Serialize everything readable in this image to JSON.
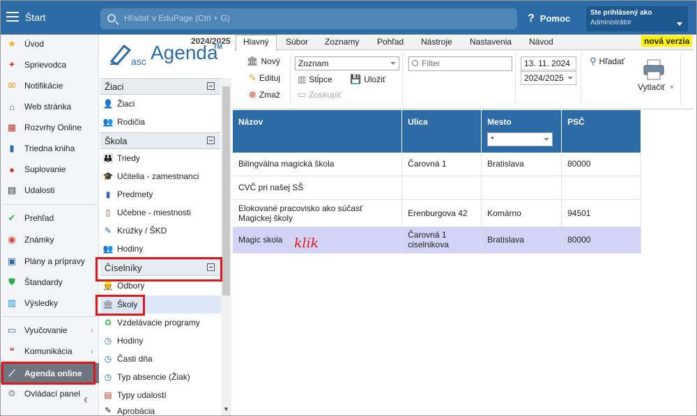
{
  "header": {
    "start_label": "Štart",
    "search_placeholder": "Hľadať v EduPage (Ctrl + G)",
    "help_label": "Pomoc",
    "user_line1": "Ste prihlásený ako",
    "user_line2": "Administrátor"
  },
  "leftnav": {
    "items": [
      {
        "label": "Úvod",
        "icon": "star-icon"
      },
      {
        "label": "Sprievodca",
        "icon": "wand-icon"
      },
      {
        "label": "Notifikácie",
        "icon": "envelope-icon"
      },
      {
        "label": "Web stránka",
        "icon": "home-icon"
      },
      {
        "label": "Rozvrhy Online",
        "icon": "grid-icon"
      },
      {
        "label": "Triedna kniha",
        "icon": "book-icon"
      },
      {
        "label": "Suplovanie",
        "icon": "person-icon"
      },
      {
        "label": "Udalosti",
        "icon": "calendar-icon"
      },
      {
        "label": "Prehľad",
        "icon": "check-circle-icon"
      },
      {
        "label": "Známky",
        "icon": "grade-icon"
      },
      {
        "label": "Plány a prípravy",
        "icon": "briefcase-icon"
      },
      {
        "label": "Štandardy",
        "icon": "shield-icon"
      },
      {
        "label": "Výsledky",
        "icon": "bar-chart-icon"
      },
      {
        "label": "Vyučovanie",
        "icon": "open-book-icon"
      },
      {
        "label": "Komunikácia",
        "icon": "chat-icon"
      },
      {
        "label": "Agenda online",
        "icon": "agenda-icon"
      },
      {
        "label": "Ovládací panel",
        "icon": "gear-icon"
      }
    ]
  },
  "col2": {
    "year": "2024/2025",
    "logo_asc": "asc",
    "logo_agenda": "Agenda",
    "logo_tm": "TM",
    "sections": {
      "ziaci": "Žiaci",
      "skola": "Škola",
      "ciselniky": "Číselníky"
    },
    "ziaci_items": [
      "Žiaci",
      "Rodičia"
    ],
    "skola_items": [
      "Triedy",
      "Učitelia - zamestnanci",
      "Predmety",
      "Učebne - miestnosti",
      "Krúžky / ŠKD",
      "Hodiny"
    ],
    "ciselniky_items": [
      "Odbory",
      "Školy",
      "Vzdelávacie programy",
      "Hodiny",
      "Časti dňa",
      "Typ absencie (Žiak)",
      "Typy udalostí",
      "Aprobácia"
    ]
  },
  "tabs": [
    "Hlavný",
    "Súbor",
    "Zoznamy",
    "Pohľad",
    "Nástroje",
    "Nastavenia",
    "Návod"
  ],
  "nova_verzia": "nová verzia",
  "toolbar": {
    "novy": "Nový",
    "edituj": "Edituj",
    "zmaz": "Zmaž",
    "zoznam": "Zoznam",
    "stlpce": "Stĺpce",
    "ulozit": "Uložiť",
    "zoskupit": "Zoskupiť",
    "filter_placeholder": "Filter",
    "date": "13. 11. 2024",
    "year": "2024/2025",
    "hladat": "Hľadať",
    "vytlacit": "Vytlačiť"
  },
  "table": {
    "headers": [
      "Názov",
      "Ulica",
      "Mesto",
      "PSČ"
    ],
    "mesto_filter": "*",
    "rows": [
      {
        "nazov": "Bilingválna magická škola",
        "ulica": "Čarovná 1",
        "mesto": "Bratislava",
        "psc": "80000"
      },
      {
        "nazov": "CVČ pri našej SŠ",
        "ulica": "",
        "mesto": "",
        "psc": ""
      },
      {
        "nazov": "Elokované pracovisko ako súčasť Magickej školy",
        "ulica": "Erenburgova 42",
        "mesto": "Komárno",
        "psc": "94501"
      },
      {
        "nazov": "Magic skola",
        "ulica": "Čarovná 1 ciselnikova",
        "mesto": "Bratislava",
        "psc": "80000"
      }
    ]
  },
  "annotation": "klik",
  "colors": {
    "primary": "#2d6ba6",
    "highlight": "#e1161c",
    "selected_row": "#d2d3f6"
  }
}
